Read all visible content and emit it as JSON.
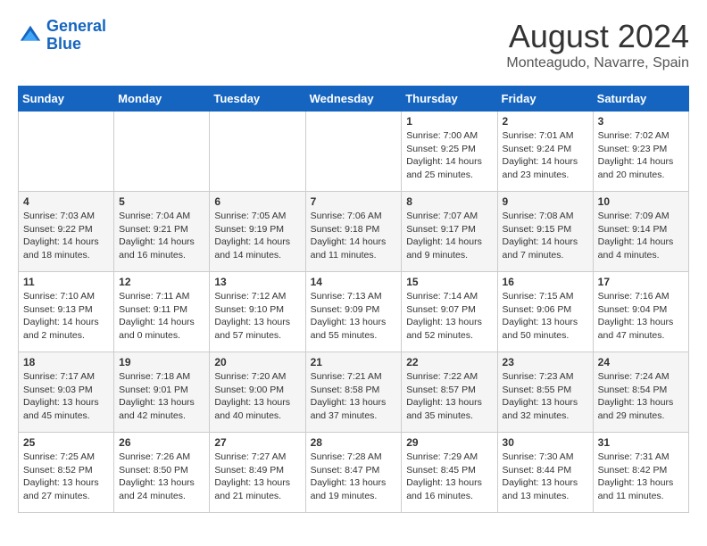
{
  "header": {
    "logo_line1": "General",
    "logo_line2": "Blue",
    "month_year": "August 2024",
    "location": "Monteagudo, Navarre, Spain"
  },
  "days": [
    "Sunday",
    "Monday",
    "Tuesday",
    "Wednesday",
    "Thursday",
    "Friday",
    "Saturday"
  ],
  "weeks": [
    [
      {
        "date": "",
        "info": ""
      },
      {
        "date": "",
        "info": ""
      },
      {
        "date": "",
        "info": ""
      },
      {
        "date": "",
        "info": ""
      },
      {
        "date": "1",
        "info": "Sunrise: 7:00 AM\nSunset: 9:25 PM\nDaylight: 14 hours\nand 25 minutes."
      },
      {
        "date": "2",
        "info": "Sunrise: 7:01 AM\nSunset: 9:24 PM\nDaylight: 14 hours\nand 23 minutes."
      },
      {
        "date": "3",
        "info": "Sunrise: 7:02 AM\nSunset: 9:23 PM\nDaylight: 14 hours\nand 20 minutes."
      }
    ],
    [
      {
        "date": "4",
        "info": "Sunrise: 7:03 AM\nSunset: 9:22 PM\nDaylight: 14 hours\nand 18 minutes."
      },
      {
        "date": "5",
        "info": "Sunrise: 7:04 AM\nSunset: 9:21 PM\nDaylight: 14 hours\nand 16 minutes."
      },
      {
        "date": "6",
        "info": "Sunrise: 7:05 AM\nSunset: 9:19 PM\nDaylight: 14 hours\nand 14 minutes."
      },
      {
        "date": "7",
        "info": "Sunrise: 7:06 AM\nSunset: 9:18 PM\nDaylight: 14 hours\nand 11 minutes."
      },
      {
        "date": "8",
        "info": "Sunrise: 7:07 AM\nSunset: 9:17 PM\nDaylight: 14 hours\nand 9 minutes."
      },
      {
        "date": "9",
        "info": "Sunrise: 7:08 AM\nSunset: 9:15 PM\nDaylight: 14 hours\nand 7 minutes."
      },
      {
        "date": "10",
        "info": "Sunrise: 7:09 AM\nSunset: 9:14 PM\nDaylight: 14 hours\nand 4 minutes."
      }
    ],
    [
      {
        "date": "11",
        "info": "Sunrise: 7:10 AM\nSunset: 9:13 PM\nDaylight: 14 hours\nand 2 minutes."
      },
      {
        "date": "12",
        "info": "Sunrise: 7:11 AM\nSunset: 9:11 PM\nDaylight: 14 hours\nand 0 minutes."
      },
      {
        "date": "13",
        "info": "Sunrise: 7:12 AM\nSunset: 9:10 PM\nDaylight: 13 hours\nand 57 minutes."
      },
      {
        "date": "14",
        "info": "Sunrise: 7:13 AM\nSunset: 9:09 PM\nDaylight: 13 hours\nand 55 minutes."
      },
      {
        "date": "15",
        "info": "Sunrise: 7:14 AM\nSunset: 9:07 PM\nDaylight: 13 hours\nand 52 minutes."
      },
      {
        "date": "16",
        "info": "Sunrise: 7:15 AM\nSunset: 9:06 PM\nDaylight: 13 hours\nand 50 minutes."
      },
      {
        "date": "17",
        "info": "Sunrise: 7:16 AM\nSunset: 9:04 PM\nDaylight: 13 hours\nand 47 minutes."
      }
    ],
    [
      {
        "date": "18",
        "info": "Sunrise: 7:17 AM\nSunset: 9:03 PM\nDaylight: 13 hours\nand 45 minutes."
      },
      {
        "date": "19",
        "info": "Sunrise: 7:18 AM\nSunset: 9:01 PM\nDaylight: 13 hours\nand 42 minutes."
      },
      {
        "date": "20",
        "info": "Sunrise: 7:20 AM\nSunset: 9:00 PM\nDaylight: 13 hours\nand 40 minutes."
      },
      {
        "date": "21",
        "info": "Sunrise: 7:21 AM\nSunset: 8:58 PM\nDaylight: 13 hours\nand 37 minutes."
      },
      {
        "date": "22",
        "info": "Sunrise: 7:22 AM\nSunset: 8:57 PM\nDaylight: 13 hours\nand 35 minutes."
      },
      {
        "date": "23",
        "info": "Sunrise: 7:23 AM\nSunset: 8:55 PM\nDaylight: 13 hours\nand 32 minutes."
      },
      {
        "date": "24",
        "info": "Sunrise: 7:24 AM\nSunset: 8:54 PM\nDaylight: 13 hours\nand 29 minutes."
      }
    ],
    [
      {
        "date": "25",
        "info": "Sunrise: 7:25 AM\nSunset: 8:52 PM\nDaylight: 13 hours\nand 27 minutes."
      },
      {
        "date": "26",
        "info": "Sunrise: 7:26 AM\nSunset: 8:50 PM\nDaylight: 13 hours\nand 24 minutes."
      },
      {
        "date": "27",
        "info": "Sunrise: 7:27 AM\nSunset: 8:49 PM\nDaylight: 13 hours\nand 21 minutes."
      },
      {
        "date": "28",
        "info": "Sunrise: 7:28 AM\nSunset: 8:47 PM\nDaylight: 13 hours\nand 19 minutes."
      },
      {
        "date": "29",
        "info": "Sunrise: 7:29 AM\nSunset: 8:45 PM\nDaylight: 13 hours\nand 16 minutes."
      },
      {
        "date": "30",
        "info": "Sunrise: 7:30 AM\nSunset: 8:44 PM\nDaylight: 13 hours\nand 13 minutes."
      },
      {
        "date": "31",
        "info": "Sunrise: 7:31 AM\nSunset: 8:42 PM\nDaylight: 13 hours\nand 11 minutes."
      }
    ]
  ]
}
